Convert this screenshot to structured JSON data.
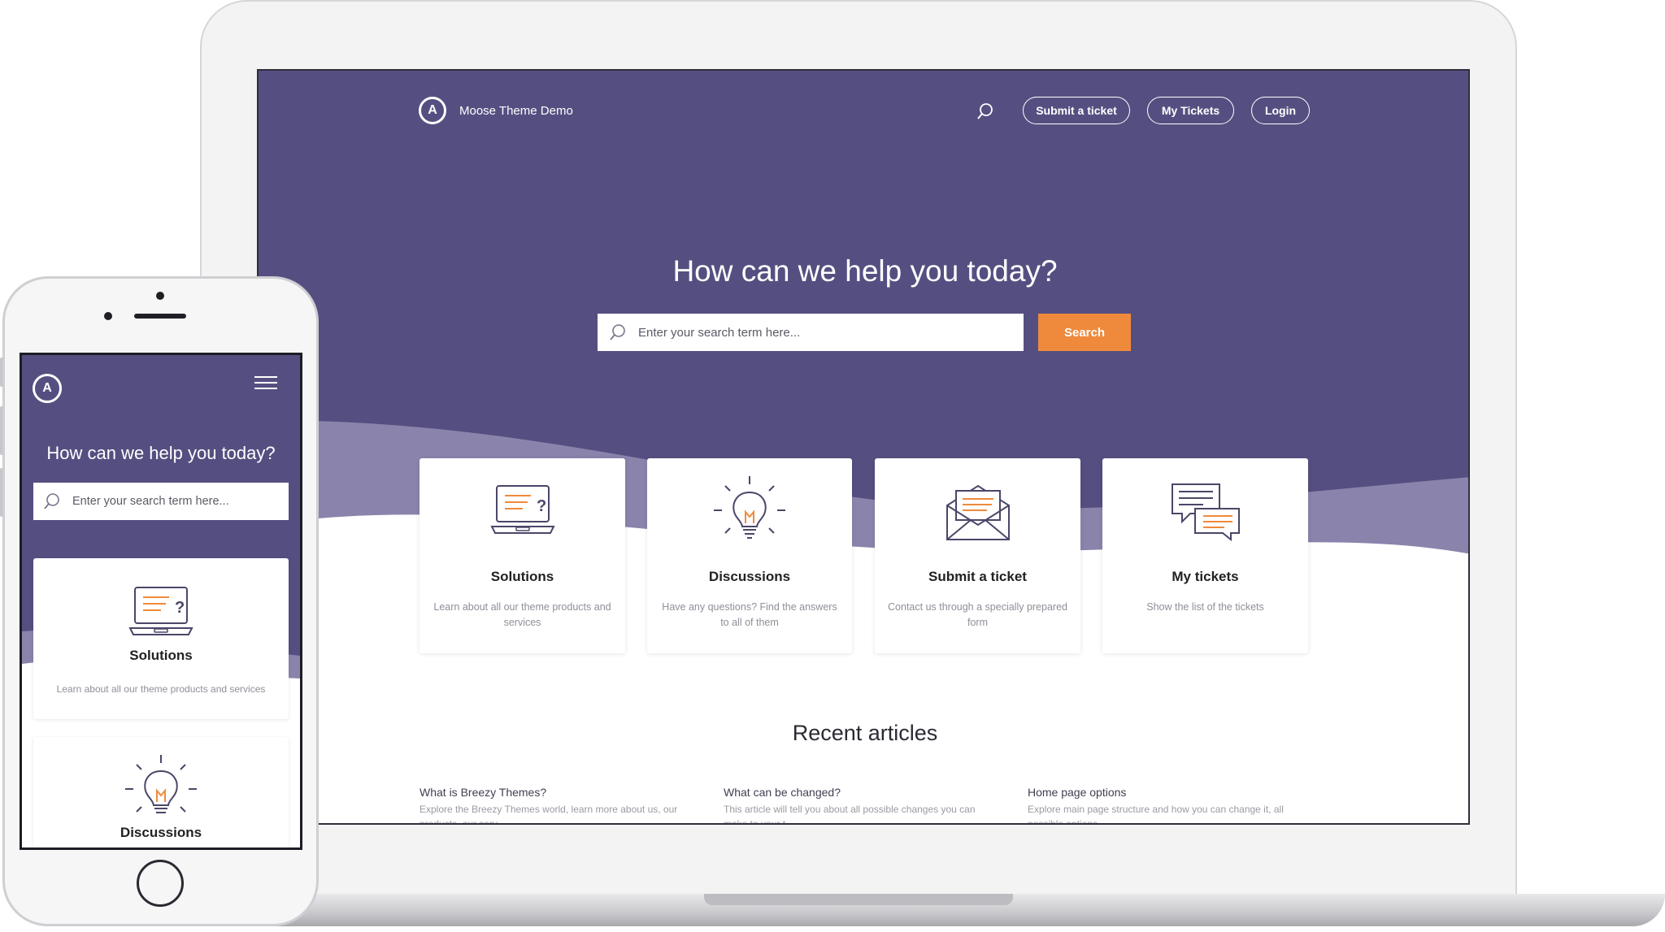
{
  "desktop": {
    "brand": {
      "name": "Moose Theme Demo",
      "logo_letter": "A"
    },
    "nav": {
      "search_icon": "search-icon",
      "submit_ticket": "Submit a ticket",
      "my_tickets": "My Tickets",
      "login": "Login"
    },
    "hero": {
      "title": "How can we help you today?",
      "search_placeholder": "Enter your search term here...",
      "search_button": "Search"
    },
    "cards": [
      {
        "icon": "laptop-question-icon",
        "title": "Solutions",
        "desc": "Learn about all our theme products and services"
      },
      {
        "icon": "lightbulb-icon",
        "title": "Discussions",
        "desc": "Have any questions? Find the answers to all of them"
      },
      {
        "icon": "envelope-icon",
        "title": "Submit a ticket",
        "desc": "Contact us through a specially prepared form"
      },
      {
        "icon": "chat-bubbles-icon",
        "title": "My tickets",
        "desc": "Show the list of the tickets"
      }
    ],
    "recent": {
      "title": "Recent articles",
      "articles": [
        {
          "title": "What is Breezy Themes?",
          "desc": "Explore the Breezy Themes world, learn more about us, our products, our serv..."
        },
        {
          "title": "What can be changed?",
          "desc": "This article will tell you about all possible changes you can make to your t..."
        },
        {
          "title": "Home page options",
          "desc": "Explore main page structure and how you can change it, all possible options..."
        }
      ]
    }
  },
  "mobile": {
    "logo_letter": "A",
    "menu_icon": "hamburger-menu-icon",
    "hero_title": "How can we help you today?",
    "search_placeholder": "Enter your search term here...",
    "cards": [
      {
        "icon": "laptop-question-icon",
        "title": "Solutions",
        "desc": "Learn about all our theme products and services"
      },
      {
        "icon": "lightbulb-icon",
        "title": "Discussions",
        "desc": ""
      }
    ]
  },
  "colors": {
    "hero": "#554f81",
    "accent": "#ef8a3c",
    "wave": "#8a84ac"
  }
}
